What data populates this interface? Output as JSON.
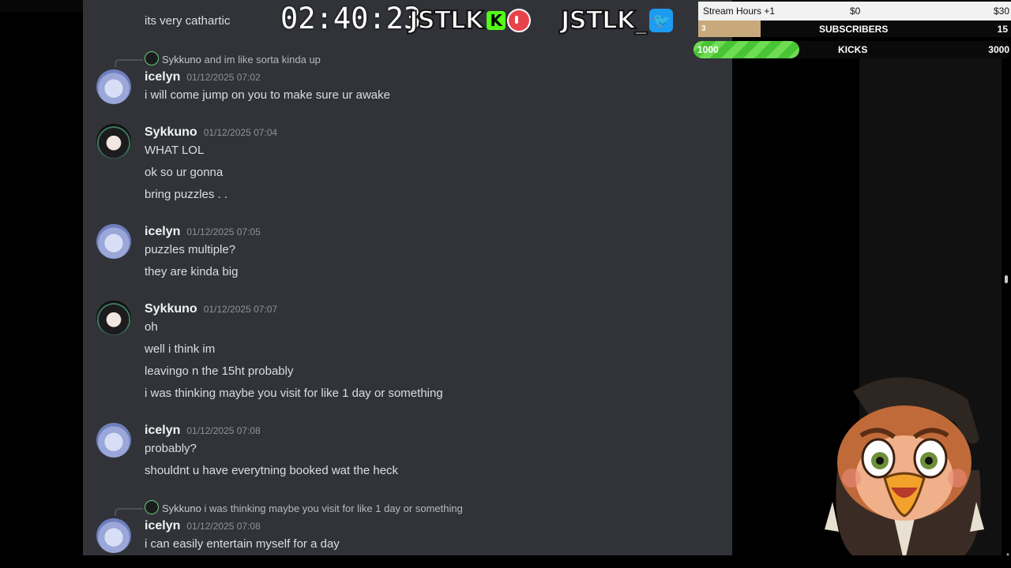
{
  "top_message": "its very cathartic",
  "timer": "02:40:23",
  "logos": {
    "kick_name": "JSTLK",
    "kick_badge": "K",
    "twitter_name": "JSTLK_",
    "twitter_badge": "🐦"
  },
  "overlay": {
    "stream_hours": {
      "label": "Stream Hours +1",
      "current": "$0",
      "goal": "$30"
    },
    "subscribers": {
      "label": "SUBSCRIBERS",
      "current": "3",
      "goal": "15",
      "progress": 0.2
    },
    "kicks": {
      "label": "KICKS",
      "current": "1000",
      "goal": "3000",
      "progress": 0.333
    }
  },
  "messages": [
    {
      "reply": {
        "name": "Sykkuno",
        "text": "and im like sorta kinda up"
      },
      "user": "icelyn",
      "time": "01/12/2025 07:02",
      "avatar": "icelyn-avatar",
      "lines": [
        "i will come jump on you to make sure ur awake"
      ]
    },
    {
      "user": "Sykkuno",
      "time": "01/12/2025 07:04",
      "avatar": "sykkuno-avatar",
      "lines": [
        "WHAT LOL",
        "ok so ur gonna",
        "bring puzzles . ."
      ]
    },
    {
      "user": "icelyn",
      "time": "01/12/2025 07:05",
      "avatar": "icelyn-avatar",
      "lines": [
        "puzzles multiple?",
        "they are kinda big"
      ]
    },
    {
      "user": "Sykkuno",
      "time": "01/12/2025 07:07",
      "avatar": "sykkuno-avatar",
      "lines": [
        "oh",
        "well i think im",
        "leavingo n the 15ht probably",
        "i was thinking maybe you visit for like 1 day or something"
      ]
    },
    {
      "user": "icelyn",
      "time": "01/12/2025 07:08",
      "avatar": "icelyn-avatar",
      "lines": [
        "probably?",
        "shouldnt u have everytning booked wat the heck"
      ]
    },
    {
      "reply": {
        "name": "Sykkuno",
        "text": "i was thinking maybe you visit for like 1 day or something"
      },
      "user": "icelyn",
      "time": "01/12/2025 07:08",
      "avatar": "icelyn-avatar",
      "lines": [
        "i can easily entertain myself for a day"
      ]
    }
  ]
}
